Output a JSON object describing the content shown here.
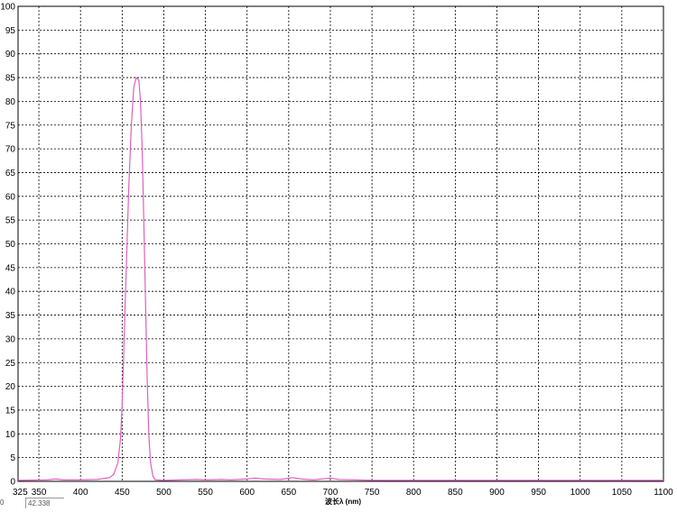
{
  "chart_data": {
    "type": "line",
    "xlabel": "波长λ (nm)",
    "ylabel": "",
    "xlim": [
      325,
      1100
    ],
    "ylim": [
      0,
      100
    ],
    "x_ticks": [
      325,
      350,
      400,
      450,
      500,
      550,
      600,
      650,
      700,
      750,
      800,
      850,
      900,
      950,
      1000,
      1050,
      1100
    ],
    "y_ticks": [
      0,
      5,
      10,
      15,
      20,
      25,
      30,
      35,
      40,
      45,
      50,
      55,
      60,
      65,
      70,
      75,
      80,
      85,
      90,
      95,
      100
    ],
    "grid": true,
    "series": [
      {
        "color": "#e060c0",
        "points": [
          [
            325,
            0.2
          ],
          [
            360,
            0.3
          ],
          [
            370,
            0.5
          ],
          [
            380,
            0.3
          ],
          [
            400,
            0.3
          ],
          [
            420,
            0.4
          ],
          [
            435,
            0.8
          ],
          [
            440,
            1.5
          ],
          [
            445,
            4
          ],
          [
            448,
            9
          ],
          [
            450,
            16
          ],
          [
            452,
            28
          ],
          [
            455,
            45
          ],
          [
            458,
            62
          ],
          [
            461,
            75
          ],
          [
            464,
            83
          ],
          [
            467,
            85
          ],
          [
            470,
            84.5
          ],
          [
            472,
            80
          ],
          [
            474,
            70
          ],
          [
            476,
            55
          ],
          [
            478,
            38
          ],
          [
            480,
            22
          ],
          [
            482,
            10
          ],
          [
            484,
            4
          ],
          [
            487,
            1
          ],
          [
            490,
            0.3
          ],
          [
            500,
            0.2
          ],
          [
            520,
            0.3
          ],
          [
            540,
            0.4
          ],
          [
            550,
            0.3
          ],
          [
            570,
            0.4
          ],
          [
            580,
            0.3
          ],
          [
            600,
            0.5
          ],
          [
            610,
            0.7
          ],
          [
            620,
            0.5
          ],
          [
            640,
            0.4
          ],
          [
            655,
            0.8
          ],
          [
            665,
            0.5
          ],
          [
            680,
            0.3
          ],
          [
            700,
            0.7
          ],
          [
            710,
            0.4
          ],
          [
            730,
            0.3
          ],
          [
            750,
            0.2
          ],
          [
            800,
            0.2
          ],
          [
            900,
            0.2
          ],
          [
            1000,
            0.2
          ],
          [
            1100,
            0.2
          ]
        ]
      }
    ]
  },
  "readout": {
    "x": "0",
    "y": "42.338"
  }
}
